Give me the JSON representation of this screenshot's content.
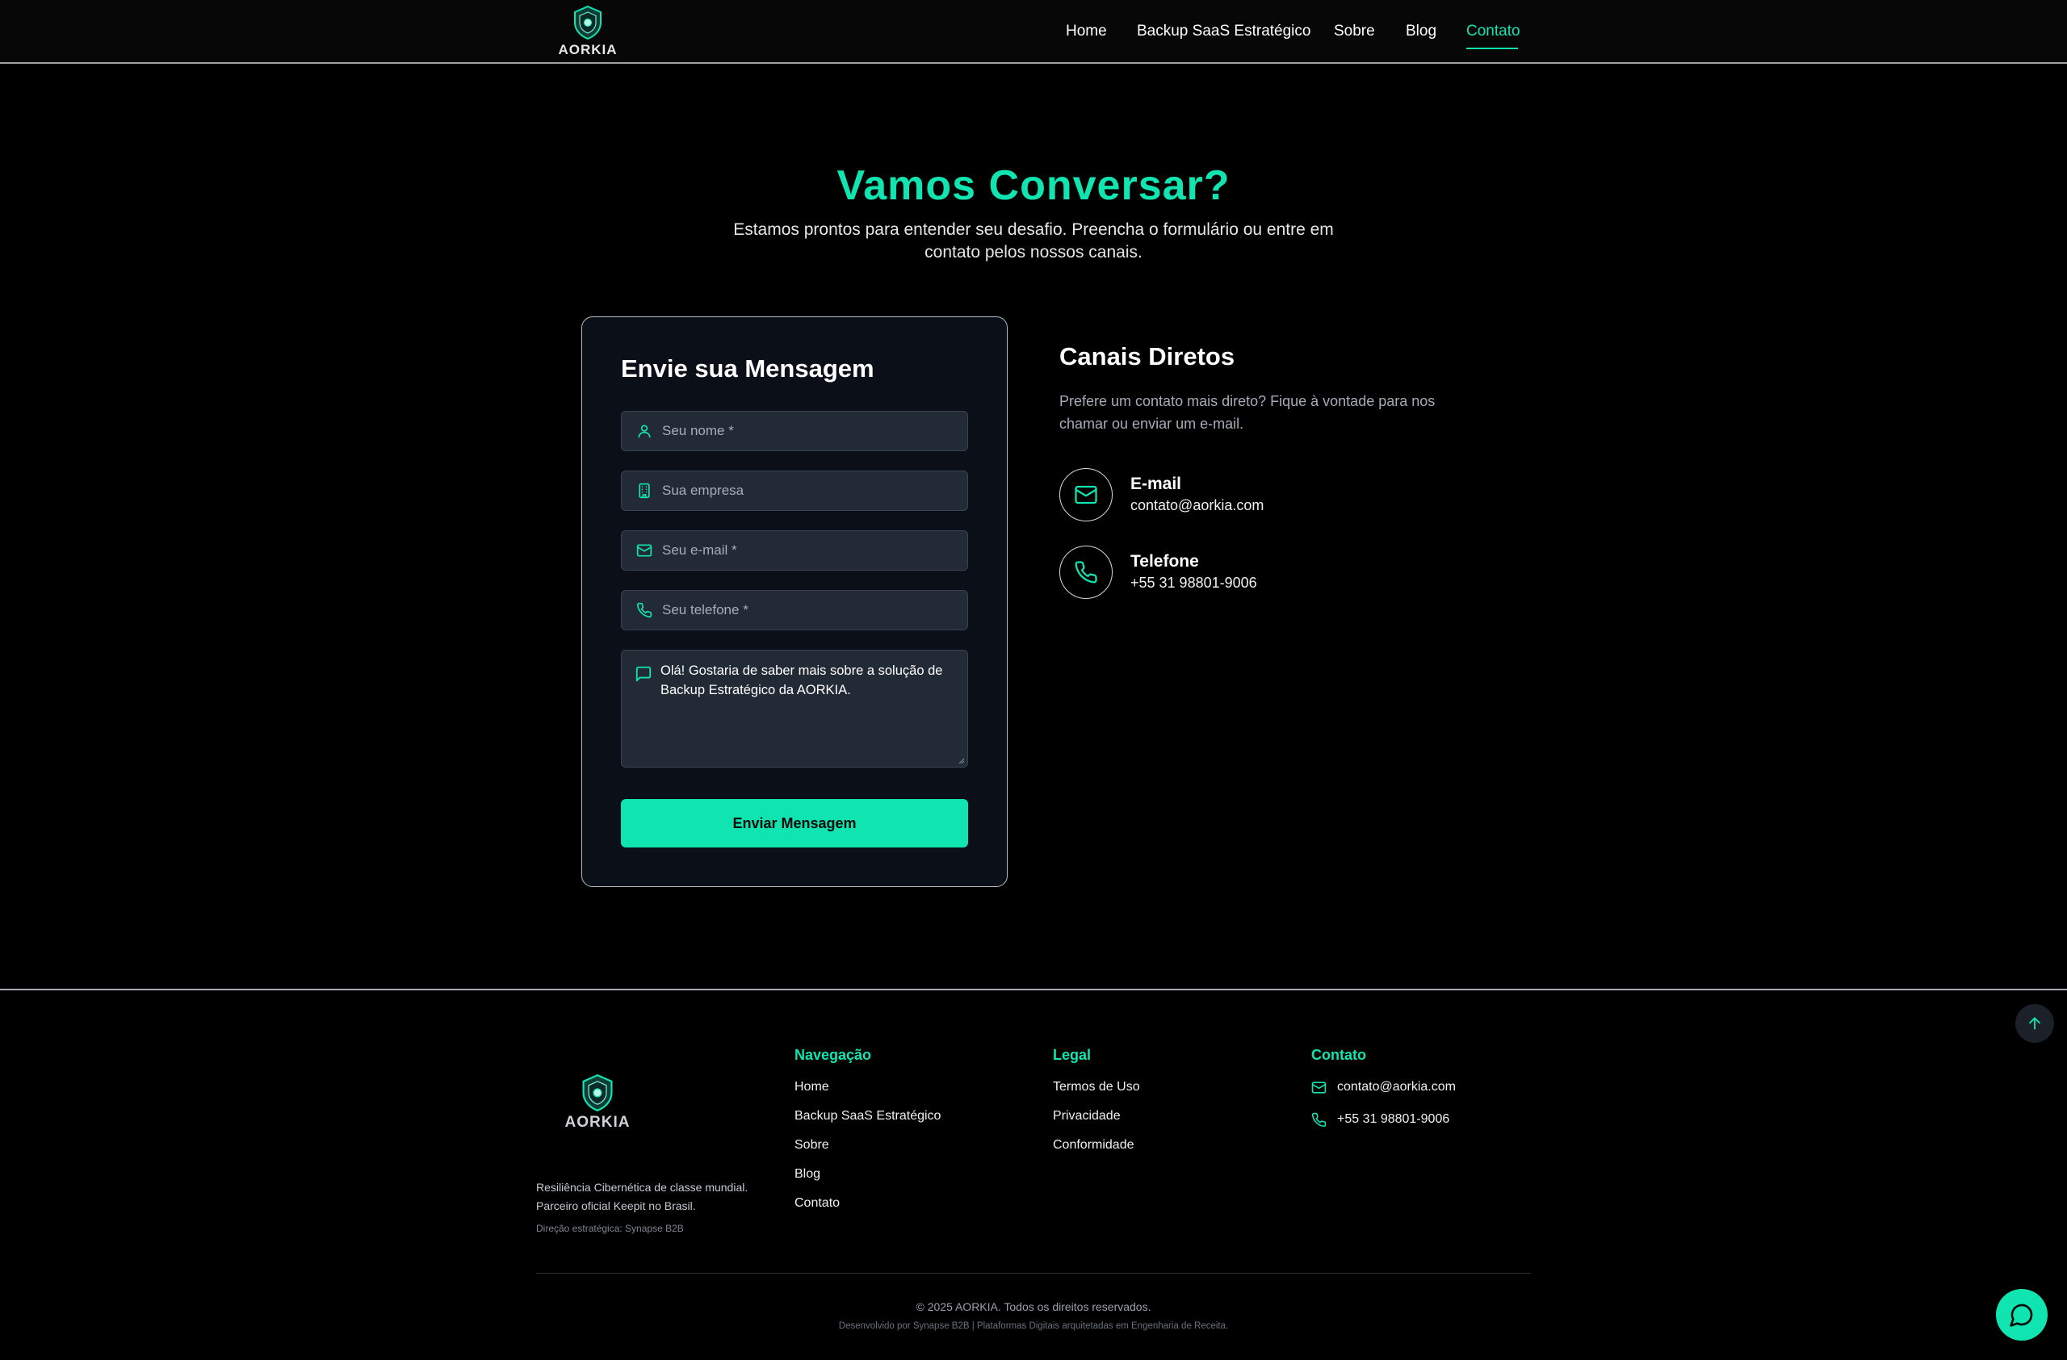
{
  "brand": {
    "name": "AORKIA"
  },
  "nav": {
    "items": [
      {
        "label": "Home"
      },
      {
        "label": "Backup SaaS Estratégico"
      },
      {
        "label": "Sobre"
      },
      {
        "label": "Blog"
      },
      {
        "label": "Contato"
      }
    ],
    "active": "Contato"
  },
  "hero": {
    "title": "Vamos Conversar?",
    "subtitle": "Estamos prontos para entender seu desafio. Preencha o formulário ou entre em contato pelos nossos canais."
  },
  "form": {
    "title": "Envie sua Mensagem",
    "fields": {
      "name_placeholder": "Seu nome *",
      "company_placeholder": "Sua empresa",
      "email_placeholder": "Seu e-mail *",
      "phone_placeholder": "Seu telefone *"
    },
    "message_value": "Olá! Gostaria de saber mais sobre a solução de Backup Estratégico da AORKIA.",
    "submit_label": "Enviar Mensagem"
  },
  "channels": {
    "title": "Canais Diretos",
    "description": "Prefere um contato mais direto? Fique à vontade para nos chamar ou enviar um e-mail.",
    "email": {
      "label": "E-mail",
      "value": "contato@aorkia.com"
    },
    "phone": {
      "label": "Telefone",
      "value": "+55 31 98801-9006"
    }
  },
  "footer": {
    "tagline_1": "Resiliência Cibernética de classe mundial.",
    "tagline_2": "Parceiro oficial Keepit no Brasil.",
    "direction": "Direção estratégica: Synapse B2B",
    "nav_title": "Navegação",
    "nav_links": [
      "Home",
      "Backup SaaS Estratégico",
      "Sobre",
      "Blog",
      "Contato"
    ],
    "legal_title": "Legal",
    "legal_links": [
      "Termos de Uso",
      "Privacidade",
      "Conformidade"
    ],
    "contact_title": "Contato",
    "contact_email": "contato@aorkia.com",
    "contact_phone": "+55 31 98801-9006",
    "copyright": "© 2025 AORKIA. Todos os direitos reservados.",
    "developed_by": "Desenvolvido por Synapse B2B | Plataformas Digitais arquitetadas em Engenharia de Receita."
  },
  "colors": {
    "accent": "#10e4b0",
    "background": "#000000",
    "card": "#0b0f17",
    "input": "#222a36"
  },
  "icons": [
    "shield-logo-icon",
    "user-icon",
    "building-icon",
    "mail-icon",
    "phone-icon",
    "message-icon",
    "arrow-up-icon",
    "chat-icon"
  ]
}
